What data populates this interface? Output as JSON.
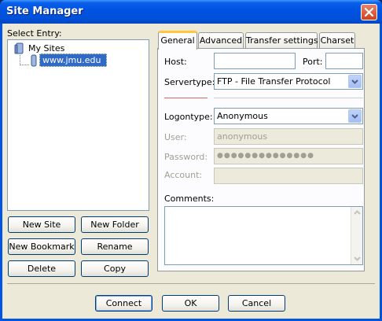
{
  "window": {
    "title": "Site Manager"
  },
  "left": {
    "select_entry_label": "Select Entry:",
    "tree": {
      "root": "My Sites",
      "selected_item": "www.jmu.edu"
    },
    "buttons": {
      "new_site": "New Site",
      "new_folder": "New Folder",
      "new_bookmark": "New Bookmark",
      "rename": "Rename",
      "delete": "Delete",
      "copy": "Copy"
    }
  },
  "tabs": [
    "General",
    "Advanced",
    "Transfer settings",
    "Charset"
  ],
  "general": {
    "host_label": "Host:",
    "host_value": "",
    "port_label": "Port:",
    "port_value": "",
    "servertype_label": "Servertype:",
    "servertype_value": "FTP - File Transfer Protocol",
    "logontype_label": "Logontype:",
    "logontype_value": "Anonymous",
    "user_label": "User:",
    "user_value": "anonymous",
    "password_label": "Password:",
    "password_value": "●●●●●●●●●●●●●●",
    "account_label": "Account:",
    "account_value": "",
    "comments_label": "Comments:",
    "comments_value": ""
  },
  "footer": {
    "connect": "Connect",
    "ok": "OK",
    "cancel": "Cancel"
  },
  "colors": {
    "titlebar": "#0054e3",
    "dialog_bg": "#ece9d8",
    "active_tab_accent": "#ffc83c"
  }
}
